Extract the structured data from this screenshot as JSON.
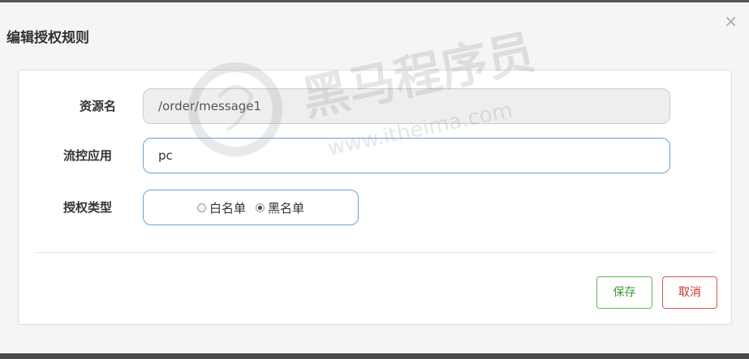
{
  "dialog": {
    "title": "编辑授权规则",
    "close_symbol": "×"
  },
  "form": {
    "resource": {
      "label": "资源名",
      "value": "/order/message1"
    },
    "app": {
      "label": "流控应用",
      "value": "pc"
    },
    "strategy": {
      "label": "授权类型",
      "options": [
        {
          "label": "白名单",
          "checked": false
        },
        {
          "label": "黑名单",
          "checked": true
        }
      ]
    }
  },
  "buttons": {
    "save_label": "保存",
    "cancel_label": "取消"
  },
  "watermark": {
    "brand": "黑马程序员",
    "url": "www.itheima.com"
  }
}
